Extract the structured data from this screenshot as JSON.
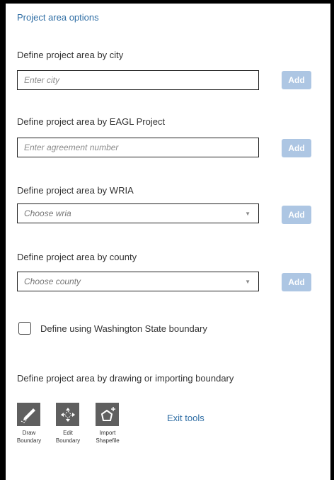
{
  "panel": {
    "title": "Project area options"
  },
  "sections": {
    "city": {
      "label": "Define project area by city",
      "placeholder": "Enter city",
      "value": "",
      "add_label": "Add"
    },
    "eagl": {
      "label": "Define project area by EAGL Project",
      "placeholder": "Enter agreement number",
      "value": "",
      "add_label": "Add"
    },
    "wria": {
      "label": "Define project area by WRIA",
      "selected": "Choose wria",
      "add_label": "Add"
    },
    "county": {
      "label": "Define project area by county",
      "selected": "Choose county",
      "add_label": "Add"
    }
  },
  "state_boundary": {
    "label": "Define using Washington State boundary",
    "checked": false
  },
  "drawing": {
    "label": "Define project area by drawing or importing boundary",
    "tools": [
      {
        "icon": "pencil-icon",
        "line1": "Draw",
        "line2": "Boundary"
      },
      {
        "icon": "move-arrows-icon",
        "line1": "Edit",
        "line2": "Boundary"
      },
      {
        "icon": "polygon-add-icon",
        "line1": "Import",
        "line2": "Shapefile"
      }
    ],
    "exit_label": "Exit tools"
  },
  "colors": {
    "link": "#2e6da4",
    "add_button_disabled": "#adc6e3",
    "tool_tile": "#5f5f5f",
    "frame": "#000000"
  }
}
